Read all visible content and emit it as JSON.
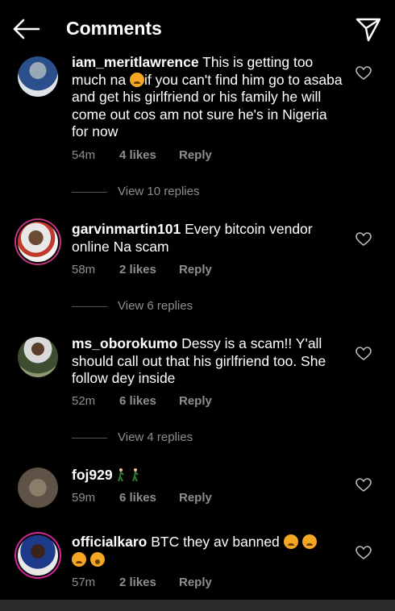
{
  "header": {
    "title": "Comments",
    "back_icon": "arrow-left-icon",
    "send_icon": "paper-plane-icon"
  },
  "comments": [
    {
      "user": "iam_meritlawrence",
      "text_a": " This is getting too much na ",
      "emoji_a": "crying-face",
      "text_b": "if you can't find him go to asaba and get his girlfriend or his family he will come out cos am not sure he's in Nigeria for now",
      "time": "54m",
      "likes": "4 likes",
      "reply": "Reply",
      "view_replies": "View 10 replies"
    },
    {
      "user": "garvinmartin101",
      "text": " Every bitcoin vendor online Na scam",
      "time": "58m",
      "likes": "2 likes",
      "reply": "Reply",
      "view_replies": "View 6 replies"
    },
    {
      "user": "ms_oborokumo",
      "text": " Dessy is a scam!! Y'all should call out that his girlfriend too. She follow dey inside",
      "time": "52m",
      "likes": "6 likes",
      "reply": "Reply",
      "view_replies": "View 4 replies"
    },
    {
      "user": "foj929",
      "text": " ",
      "emoji": [
        "person-walking",
        "person-walking"
      ],
      "time": "59m",
      "likes": "6 likes",
      "reply": "Reply"
    },
    {
      "user": "officialkaro",
      "text": " BTC they av banned ",
      "emoji": [
        "crying-face",
        "crying-face",
        "crying-face",
        "astonished-face"
      ],
      "time": "57m",
      "likes": "2 likes",
      "reply": "Reply"
    }
  ]
}
